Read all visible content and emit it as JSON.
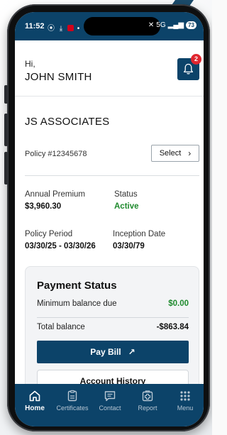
{
  "status_bar": {
    "time": "11:52",
    "left_icons": "⦿ ⤓",
    "network": "5G",
    "battery": "73"
  },
  "greeting": {
    "hi": "Hi,",
    "name": "JOHN SMITH"
  },
  "notifications": {
    "count": "2"
  },
  "account": {
    "company": "JS ASSOCIATES",
    "policy_number": "Policy #12345678",
    "select_label": "Select",
    "select_chevron": "›"
  },
  "details": {
    "annual_premium_label": "Annual Premium",
    "annual_premium_value": "$3,960.30",
    "status_label": "Status",
    "status_value": "Active",
    "policy_period_label": "Policy Period",
    "policy_period_value": "03/30/25 - 03/30/26",
    "inception_date_label": "Inception Date",
    "inception_date_value": "03/30/79"
  },
  "payment": {
    "title": "Payment Status",
    "min_balance_label": "Minimum balance due",
    "min_balance_value": "$0.00",
    "total_balance_label": "Total balance",
    "total_balance_value": "-$863.84",
    "pay_bill_label": "Pay Bill",
    "pay_bill_arrow": "↗",
    "account_history_label": "Account History"
  },
  "tabs": [
    {
      "label": "Home",
      "icon": "home-icon",
      "active": true
    },
    {
      "label": "Certificates",
      "icon": "document-icon",
      "active": false
    },
    {
      "label": "Contact",
      "icon": "chat-icon",
      "active": false
    },
    {
      "label": "Report",
      "icon": "medical-plus-icon",
      "active": false
    },
    {
      "label": "Menu",
      "icon": "grid-dots-icon",
      "active": false
    }
  ],
  "colors": {
    "brand_navy": "#0c4369",
    "active_green": "#1e8a2d",
    "badge_red": "#e0262f"
  }
}
